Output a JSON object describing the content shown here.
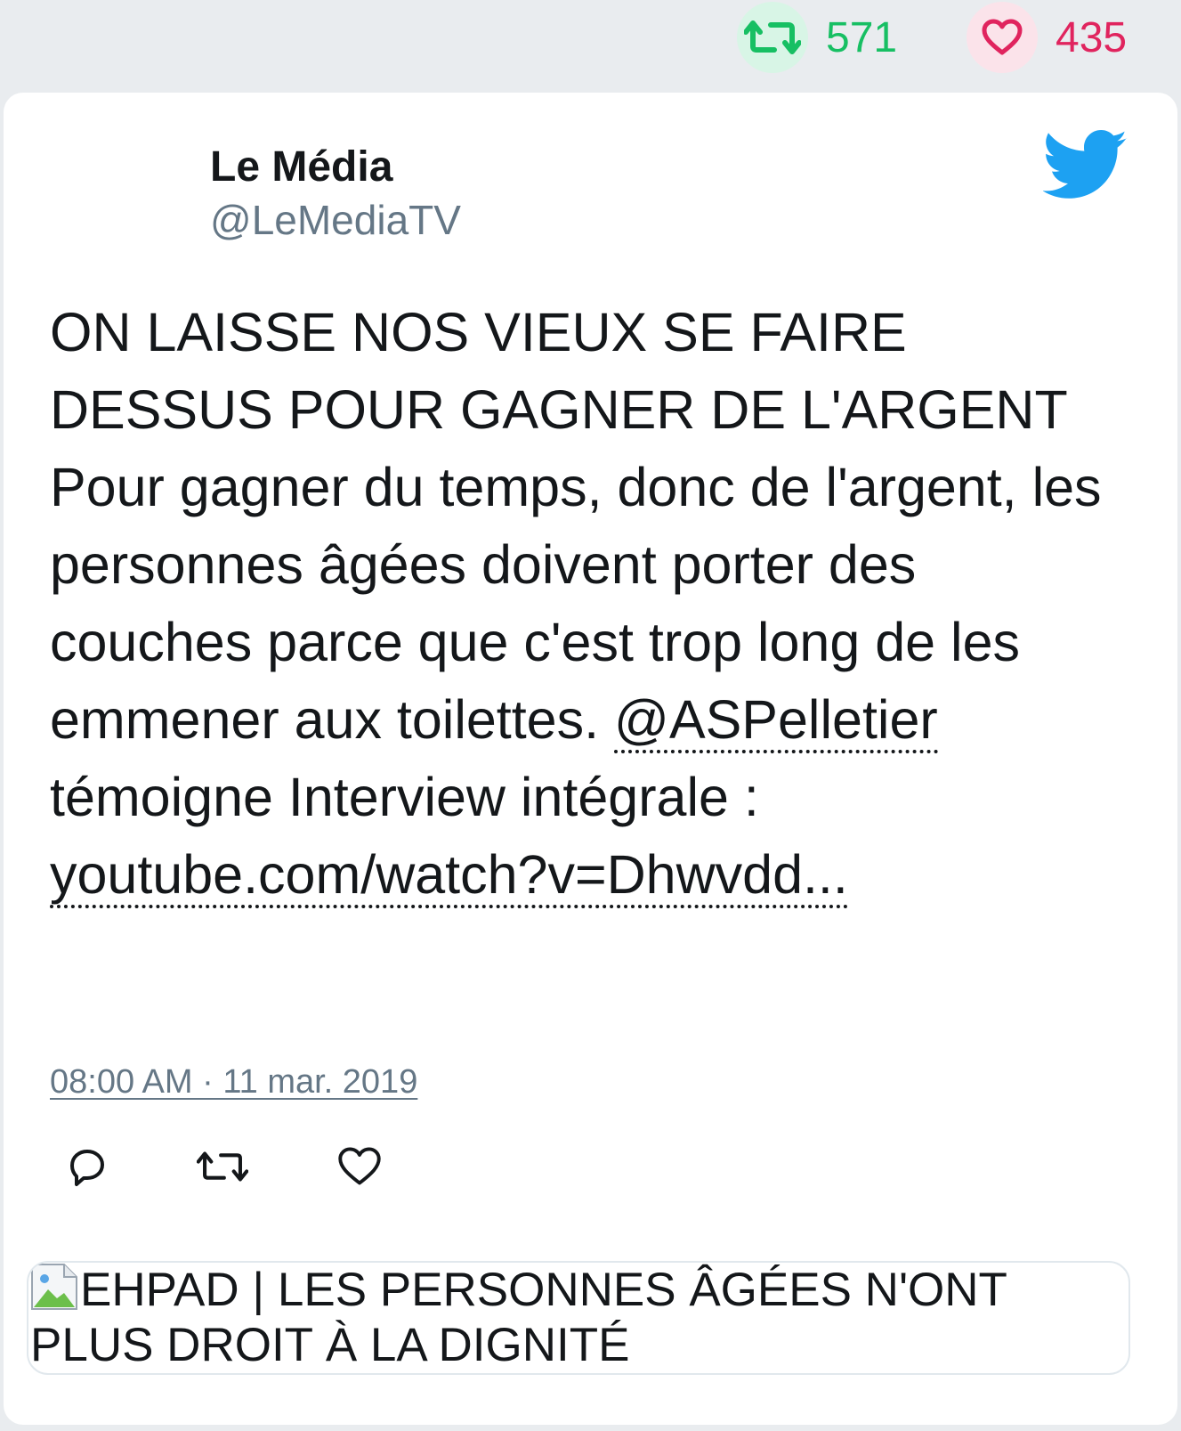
{
  "stats": {
    "retweets": "571",
    "likes": "435",
    "retweet_color": "#17bf63",
    "like_color": "#e0245e"
  },
  "tweet": {
    "author_name": "Le Média",
    "author_handle": "@LeMediaTV",
    "text_part1": "ON LAISSE NOS VIEUX SE FAIRE DESSUS POUR GAGNER DE L'ARGENT Pour gagner du temps, donc de l'argent, les personnes âgées doivent porter des couches parce que c'est trop long de les emmener aux toilettes. ",
    "mention": "@ASPelletier",
    "text_part2": " témoigne Interview intégrale : ",
    "link": "youtube.com/watch?v=Dhwvdd...",
    "timestamp": "08:00 AM · 11 mar. 2019",
    "brand_icon": "twitter-bird-icon",
    "brand_color": "#1da1f2"
  },
  "actions": {
    "reply_icon": "reply-icon",
    "retweet_icon": "retweet-icon",
    "like_icon": "heart-icon"
  },
  "preview": {
    "image_icon": "broken-image-icon",
    "title": "EHPAD | LES PERSONNES ÂGÉES N'ONT PLUS DROIT À LA DIGNITÉ"
  }
}
